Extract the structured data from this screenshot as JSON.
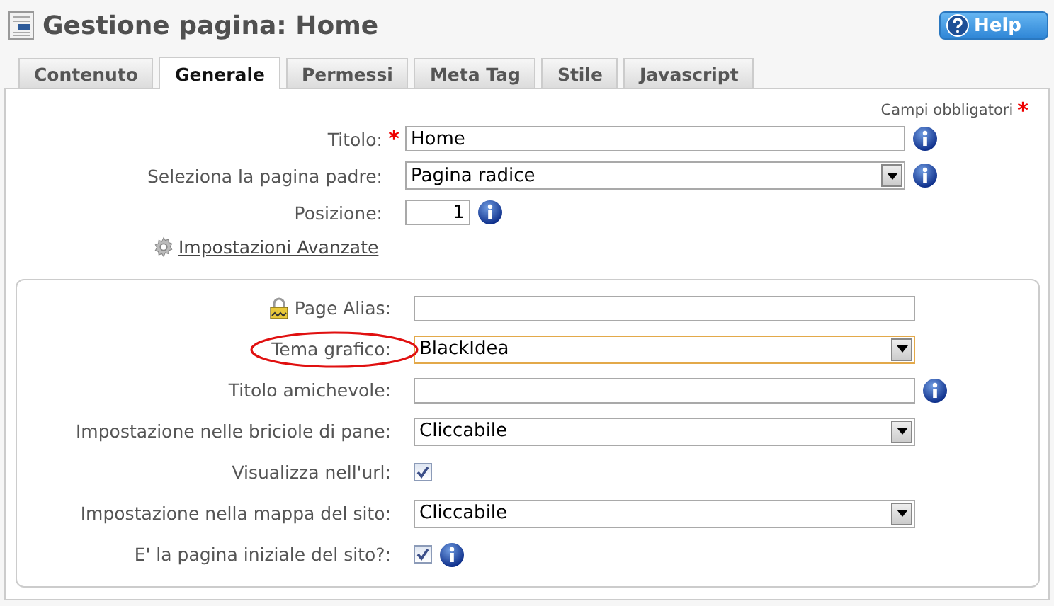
{
  "header": {
    "title": "Gestione pagina: Home",
    "help_button": "Help"
  },
  "tabs": [
    {
      "label": "Contenuto",
      "selected": false
    },
    {
      "label": "Generale",
      "selected": true
    },
    {
      "label": "Permessi",
      "selected": false
    },
    {
      "label": "Meta Tag",
      "selected": false
    },
    {
      "label": "Stile",
      "selected": false
    },
    {
      "label": "Javascript",
      "selected": false
    }
  ],
  "required_note": {
    "text": "Campi obbligatori",
    "mark": "*"
  },
  "main_fields": [
    {
      "kind": "text",
      "label": "Titolo:",
      "required": true,
      "value": "Home",
      "info": true
    },
    {
      "kind": "select",
      "label": "Seleziona la pagina padre:",
      "required": false,
      "value": "Pagina radice",
      "info": true
    },
    {
      "kind": "number",
      "label": "Posizione:",
      "required": false,
      "value": "1",
      "info": true
    }
  ],
  "advanced_link": "Impostazioni Avanzate",
  "advanced_fields": [
    {
      "kind": "text",
      "label": "Page Alias:",
      "lock": true,
      "info": false
    },
    {
      "kind": "select",
      "label": "Tema grafico:",
      "value": "BlackIdea",
      "focused": true,
      "circled": true,
      "info": false
    },
    {
      "kind": "text",
      "label": "Titolo amichevole:",
      "info": true
    },
    {
      "kind": "select",
      "label": "Impostazione nelle briciole di pane:",
      "value": "Cliccabile",
      "info": false
    },
    {
      "kind": "checkbox",
      "label": "Visualizza nell'url:",
      "checked": true,
      "info": false
    },
    {
      "kind": "select",
      "label": "Impostazione nella mappa del sito:",
      "value": "Cliccabile",
      "info": false
    },
    {
      "kind": "checkbox",
      "label": "E' la pagina iniziale del sito?:",
      "checked": true,
      "info": true
    }
  ]
}
